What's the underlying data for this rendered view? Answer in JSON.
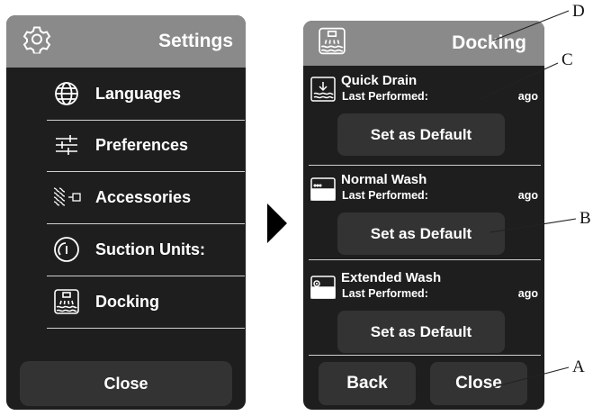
{
  "settings": {
    "title": "Settings",
    "header_icon": "gear-icon",
    "menu": [
      {
        "label": "Languages",
        "icon": "globe-icon"
      },
      {
        "label": "Preferences",
        "icon": "sliders-icon"
      },
      {
        "label": "Accessories",
        "icon": "accessories-icon"
      },
      {
        "label": "Suction Units:",
        "icon": "gauge-icon"
      },
      {
        "label": "Docking",
        "icon": "docking-icon"
      }
    ],
    "close_label": "Close"
  },
  "docking": {
    "title": "Docking",
    "header_icon": "docking-icon",
    "washes": [
      {
        "title": "Quick Drain",
        "last_label": "Last Performed:",
        "ago": "ago",
        "button": "Set as Default",
        "icon": "quick-drain-icon"
      },
      {
        "title": "Normal Wash",
        "last_label": "Last Performed:",
        "ago": "ago",
        "button": "Set as Default",
        "icon": "normal-wash-icon"
      },
      {
        "title": "Extended Wash",
        "last_label": "Last Performed:",
        "ago": "ago",
        "button": "Set as Default",
        "icon": "extended-wash-icon"
      }
    ],
    "back_label": "Back",
    "close_label": "Close"
  },
  "callouts": {
    "a": "A",
    "b": "B",
    "c": "C",
    "d": "D"
  },
  "colors": {
    "header": "#8a8a8a",
    "panel": "#1e1e1e",
    "button": "#333333",
    "text": "#ffffff"
  }
}
